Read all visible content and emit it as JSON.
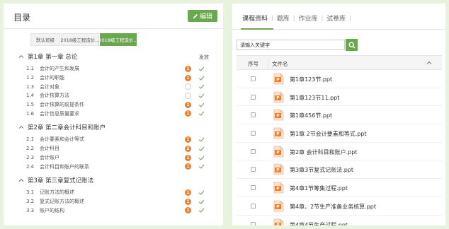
{
  "colors": {
    "accent": "#6aa84f",
    "badge": "#ef7d2d",
    "background": "#e9f2dc"
  },
  "left": {
    "title": "目录",
    "edit_label": "编辑",
    "tabs": [
      {
        "label": "默认班级",
        "active": false
      },
      {
        "label": "2018级工程造价...",
        "active": false
      },
      {
        "label": "2018级工程造价...",
        "active": true
      }
    ],
    "publish_header": "发放",
    "chapters": [
      {
        "title": "第1章 第一章 总论",
        "sections": [
          {
            "num": "1.1",
            "name": "会计的产生和发展",
            "badge": "1",
            "checked": true
          },
          {
            "num": "1.2",
            "name": "会计的职能",
            "badge": "1",
            "checked": true
          },
          {
            "num": "1.3",
            "name": "会计对象",
            "badge": "",
            "checked": true
          },
          {
            "num": "1.4",
            "name": "会计核算方法",
            "badge": "",
            "checked": true
          },
          {
            "num": "1.5",
            "name": "会计核算的前提条件",
            "badge": "1",
            "checked": true
          },
          {
            "num": "1.6",
            "name": "会计信息质量要求",
            "badge": "1",
            "checked": true
          }
        ]
      },
      {
        "title": "第2章 第二章会计科目和账户",
        "sections": [
          {
            "num": "2.1",
            "name": "会计要素和会计等式",
            "badge": "1",
            "checked": true
          },
          {
            "num": "2.2",
            "name": "会计科目",
            "badge": "2",
            "checked": true
          },
          {
            "num": "2.3",
            "name": "会计账户",
            "badge": "1",
            "checked": true
          },
          {
            "num": "2.4",
            "name": "会计科目和账户的联系",
            "badge": "1",
            "checked": true
          }
        ]
      },
      {
        "title": "第3章 第三章复式记账法",
        "sections": [
          {
            "num": "3.1",
            "name": "记账方法的概述",
            "badge": "1",
            "checked": true
          },
          {
            "num": "3.2",
            "name": "复式记账方法的概述",
            "badge": "1",
            "checked": true
          },
          {
            "num": "3.3",
            "name": "账户的结构",
            "badge": "1",
            "checked": true
          }
        ]
      }
    ]
  },
  "right": {
    "tabs": [
      {
        "label": "课程资料",
        "active": true
      },
      {
        "label": "题库",
        "active": false
      },
      {
        "label": "作业库",
        "active": false
      },
      {
        "label": "试卷库",
        "active": false
      }
    ],
    "search_placeholder": "请输入关键字",
    "columns": {
      "seq": "序号",
      "name": "文件名"
    },
    "files": [
      "第1章123节.ppt",
      "第1章123节11.ppt",
      "第1章456节.ppt",
      "第1章 2节会计要素和等式.ppt",
      "第2章 会计科目和账户.ppt",
      "第3章3节复式记账法.ppt",
      "第4章1节筹集过程.ppt",
      "第4章、2节生产准备业务核算.ppt",
      "第4章4节生产过程.ppt"
    ]
  }
}
